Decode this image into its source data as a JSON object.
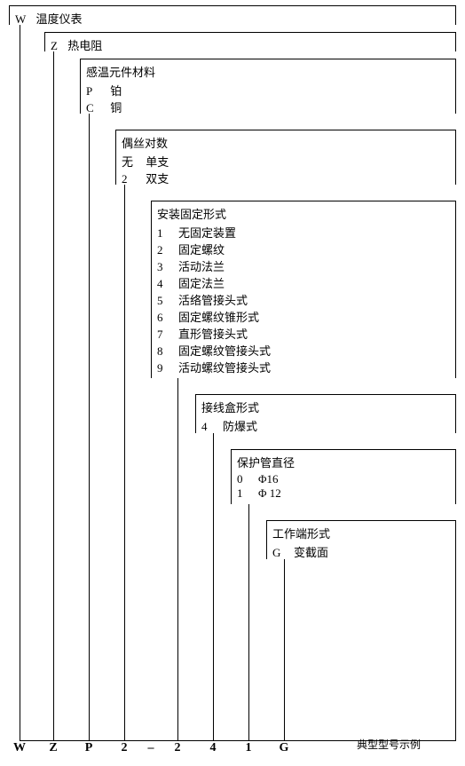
{
  "levels": [
    {
      "code": "W",
      "title": "温度仪表",
      "items": []
    },
    {
      "code": "Z",
      "title": "热电阻",
      "items": []
    },
    {
      "title": "感温元件材料",
      "items": [
        {
          "k": "P",
          "v": "铂"
        },
        {
          "k": "C",
          "v": "铜"
        }
      ]
    },
    {
      "title": "偶丝对数",
      "items": [
        {
          "k": "无",
          "v": "单支"
        },
        {
          "k": "2",
          "v": "双支"
        }
      ]
    },
    {
      "title": "安装固定形式",
      "items": [
        {
          "k": "1",
          "v": "无固定装置"
        },
        {
          "k": "2",
          "v": "固定螺纹"
        },
        {
          "k": "3",
          "v": "活动法兰"
        },
        {
          "k": "4",
          "v": "固定法兰"
        },
        {
          "k": "5",
          "v": "活络管接头式"
        },
        {
          "k": "6",
          "v": "固定螺纹锥形式"
        },
        {
          "k": "7",
          "v": "直形管接头式"
        },
        {
          "k": "8",
          "v": "固定螺纹管接头式"
        },
        {
          "k": "9",
          "v": "活动螺纹管接头式"
        }
      ]
    },
    {
      "title": "接线盒形式",
      "items": [
        {
          "k": "4",
          "v": "防爆式"
        }
      ]
    },
    {
      "title": "保护管直径",
      "items": [
        {
          "k": "0",
          "v": "Φ16"
        },
        {
          "k": "1",
          "v": "Φ 12"
        }
      ]
    },
    {
      "title": "工作端形式",
      "items": [
        {
          "k": "G",
          "v": "变截面"
        }
      ]
    }
  ],
  "bottom_codes": [
    "W",
    "Z",
    "P",
    "2",
    "–",
    "2",
    "4",
    "1",
    "G"
  ],
  "legend": "典型型号示例"
}
